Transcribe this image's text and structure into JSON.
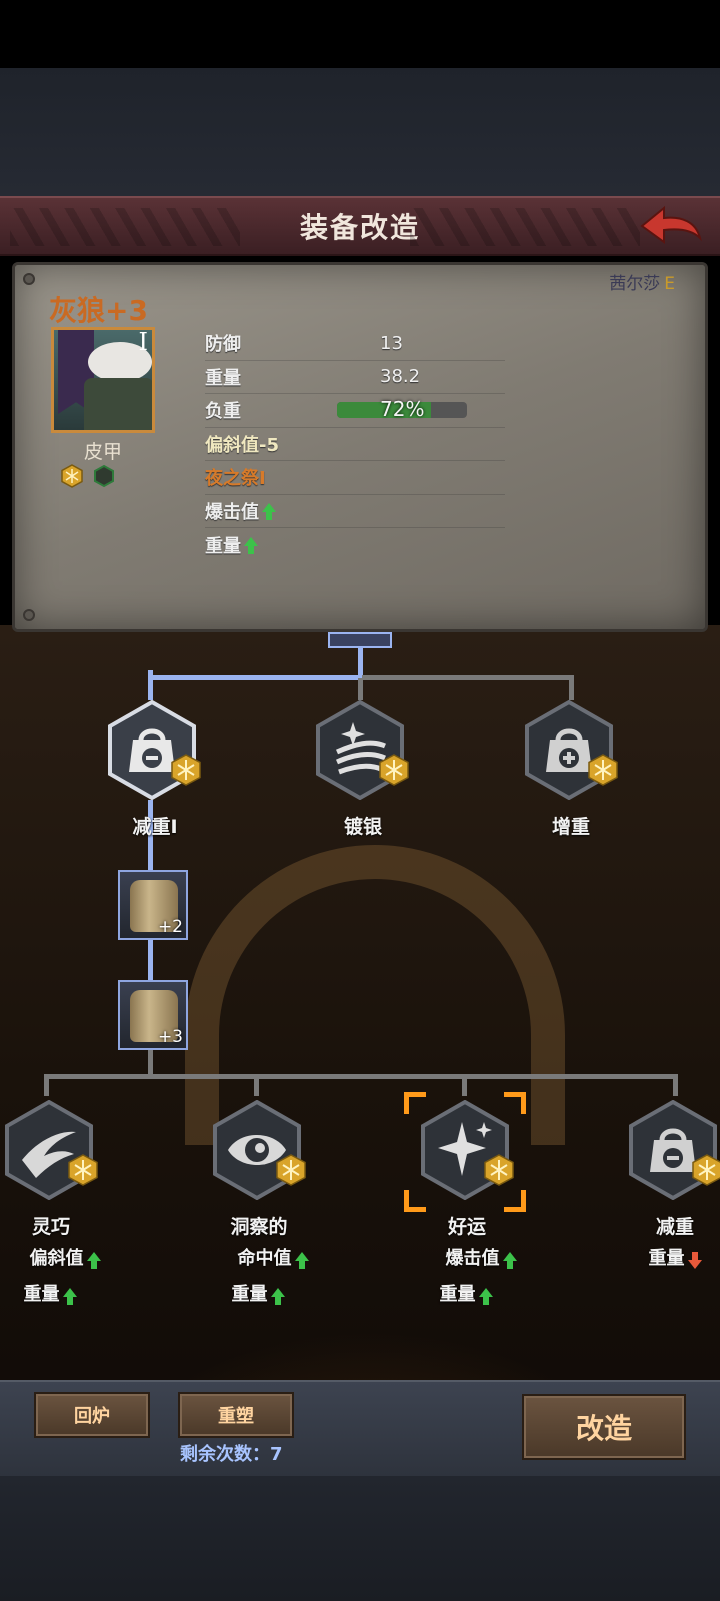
{
  "header": {
    "title": "装备改造"
  },
  "owner": {
    "name": "茜尔莎",
    "grade": "E"
  },
  "item": {
    "name": "灰狼+3",
    "tier": "I",
    "type": "皮甲"
  },
  "stats": [
    {
      "label": "防御",
      "value": "13"
    },
    {
      "label": "重量",
      "value": "38.2"
    },
    {
      "label": "负重",
      "value": "72%",
      "fraction": 0.72
    },
    {
      "label": "偏斜值-5",
      "value": ""
    },
    {
      "label": "夜之祭I",
      "value": ""
    },
    {
      "label": "爆击值",
      "value": "",
      "arrow": "up"
    },
    {
      "label": "重量",
      "value": "",
      "arrow": "up"
    }
  ],
  "tree": {
    "tier1": [
      {
        "label": "减重I",
        "icon": "weight-minus-icon"
      },
      {
        "label": "镀银",
        "icon": "silver-sparkle-icon"
      },
      {
        "label": "增重",
        "icon": "weight-plus-icon"
      }
    ],
    "upgrades": [
      {
        "level": "+2"
      },
      {
        "level": "+3"
      }
    ],
    "tier2": [
      {
        "label": "灵巧",
        "icon": "swift-icon",
        "effects": [
          {
            "text": "偏斜值",
            "arrow": "up"
          },
          {
            "text": "重量",
            "arrow": "up"
          }
        ]
      },
      {
        "label": "洞察的",
        "icon": "eye-icon",
        "effects": [
          {
            "text": "命中值",
            "arrow": "up"
          },
          {
            "text": "重量",
            "arrow": "up"
          }
        ]
      },
      {
        "label": "好运",
        "icon": "sparkle-icon",
        "selected": true,
        "effects": [
          {
            "text": "爆击值",
            "arrow": "up"
          },
          {
            "text": "重量",
            "arrow": "up"
          }
        ]
      },
      {
        "label": "减重",
        "icon": "weight-minus-icon",
        "effects": [
          {
            "text": "重量",
            "arrow": "down"
          }
        ]
      }
    ]
  },
  "buttons": {
    "smelt": "回炉",
    "reshape": "重塑",
    "modify": "改造"
  },
  "remaining": "剩余次数：7",
  "colors": {
    "accent_orange": "#c96a23",
    "selection": "#ff9a1a",
    "path_blue": "#9bb4f0",
    "up_green": "#3cc24a",
    "down_red": "#e8593a"
  }
}
